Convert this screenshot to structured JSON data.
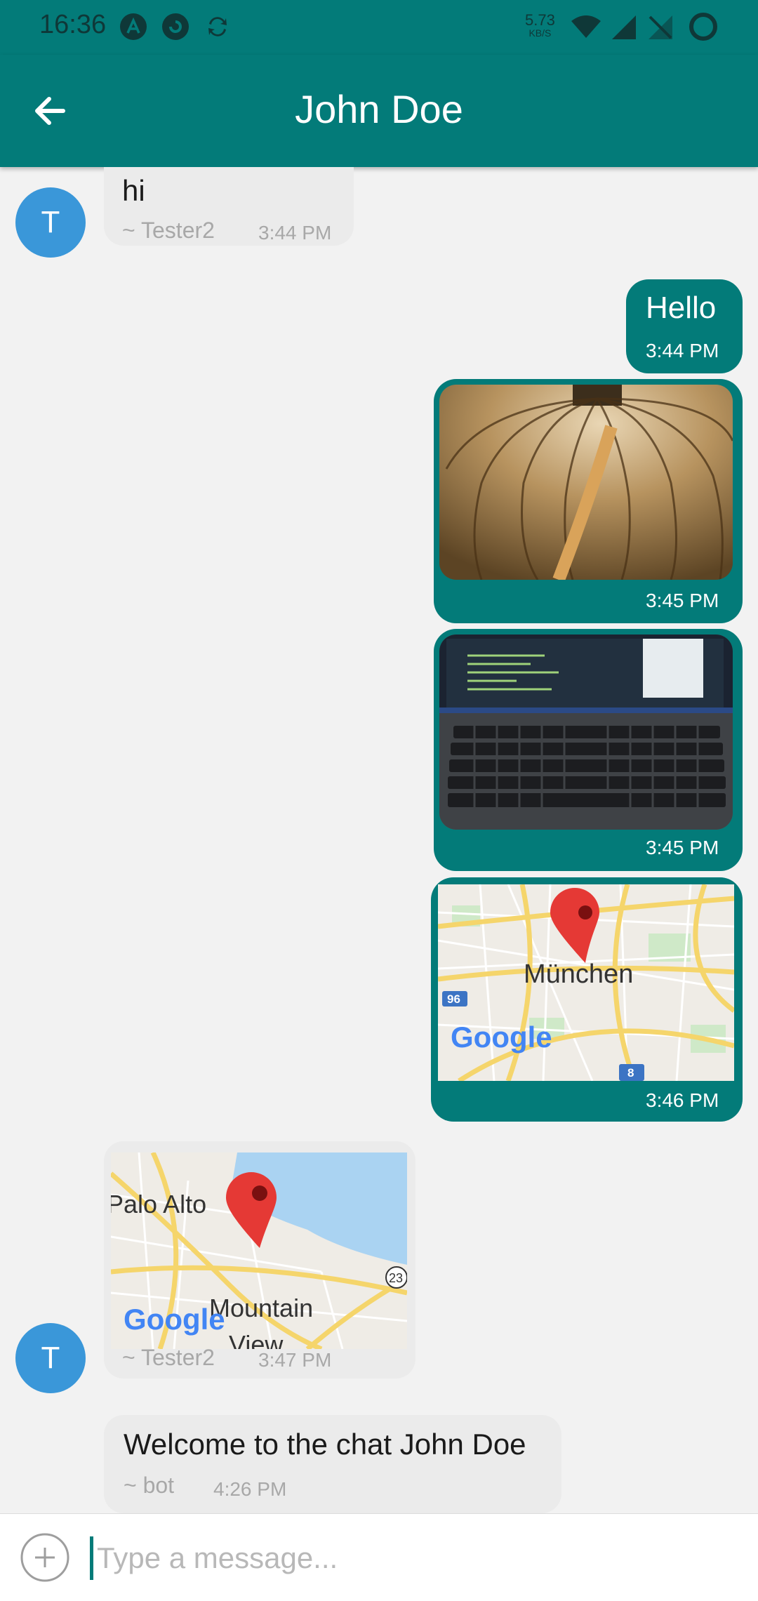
{
  "status_bar": {
    "time": "16:36",
    "speed_value": "5.73",
    "speed_unit": "KB/S",
    "icons": [
      "app-a-icon",
      "app-refresh-icon",
      "sync-icon",
      "wifi-icon",
      "signal-icon",
      "no-sim-icon",
      "battery-ring-icon"
    ]
  },
  "header": {
    "title": "John Doe",
    "back_icon": "arrow-left-icon"
  },
  "messages": [
    {
      "direction": "incoming",
      "type": "text",
      "text": "hi",
      "sender": "~ Tester2",
      "time": "3:44 PM",
      "avatar": "T"
    },
    {
      "direction": "outgoing",
      "type": "text",
      "text": "Hello",
      "time": "3:44 PM"
    },
    {
      "direction": "outgoing",
      "type": "image",
      "description": "leaf",
      "time": "3:45 PM"
    },
    {
      "direction": "outgoing",
      "type": "image",
      "description": "laptop",
      "time": "3:45 PM"
    },
    {
      "direction": "outgoing",
      "type": "location",
      "map_label": "München",
      "map_logo": "Google",
      "road_badges": [
        "96",
        "8"
      ],
      "time": "3:46 PM"
    },
    {
      "direction": "incoming",
      "type": "location",
      "map_labels": [
        "Palo Alto",
        "Mountain",
        "View"
      ],
      "map_logo": "Google",
      "road_badge": "23",
      "sender": "~ Tester2",
      "time": "3:47 PM",
      "avatar": "T"
    },
    {
      "direction": "incoming",
      "type": "text",
      "text": "Welcome to the chat John Doe",
      "sender": "~ bot",
      "time": "4:26 PM"
    }
  ],
  "composer": {
    "placeholder": "Type a message...",
    "add_icon": "plus-circle-icon"
  },
  "colors": {
    "primary": "#037b79",
    "avatar": "#3a97d9",
    "incoming_bubble": "#ebebeb",
    "background": "#f2f2f2"
  }
}
